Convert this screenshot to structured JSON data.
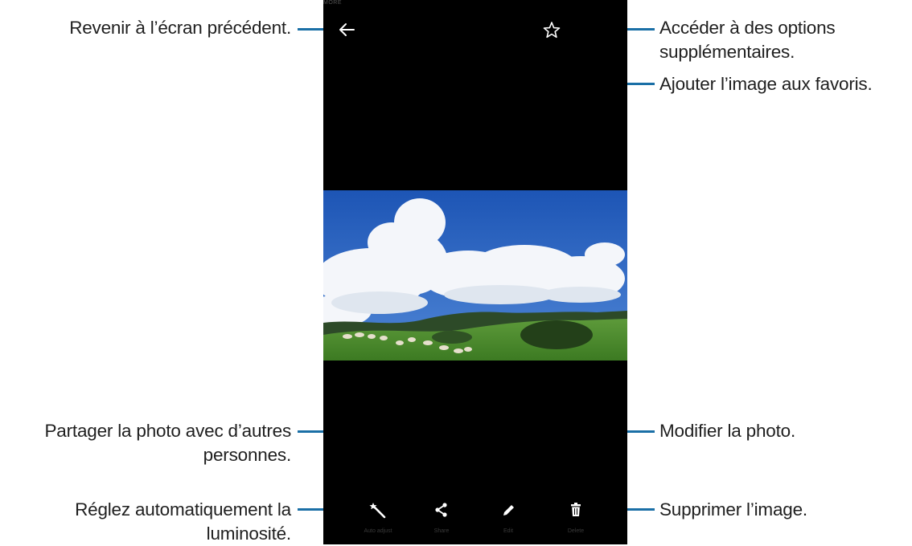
{
  "callouts": {
    "back": "Revenir à l’écran précédent.",
    "more_line1": "Accéder à des options",
    "more_line2": "supplémentaires.",
    "favorite": "Ajouter l’image aux favoris.",
    "share_line1": "Partager la photo avec d’autres",
    "share_line2": "personnes.",
    "edit": "Modifier la photo.",
    "auto_line1": "Réglez automatiquement la",
    "auto_line2": "luminosité.",
    "delete": "Supprimer l’image."
  },
  "phone": {
    "topbar": {
      "more_label": "MORE"
    },
    "bottom_bar": {
      "auto_adjust_label": "Auto adjust",
      "share_label": "Share",
      "edit_label": "Edit",
      "delete_label": "Delete"
    }
  },
  "icons": {
    "back": "arrow-left-icon",
    "favorite": "star-outline-icon",
    "auto_adjust": "magic-wand-icon",
    "share": "share-icon",
    "edit": "pencil-icon",
    "delete": "trash-icon"
  },
  "colors": {
    "leader": "#1a6fa6",
    "screen": "#000000"
  }
}
